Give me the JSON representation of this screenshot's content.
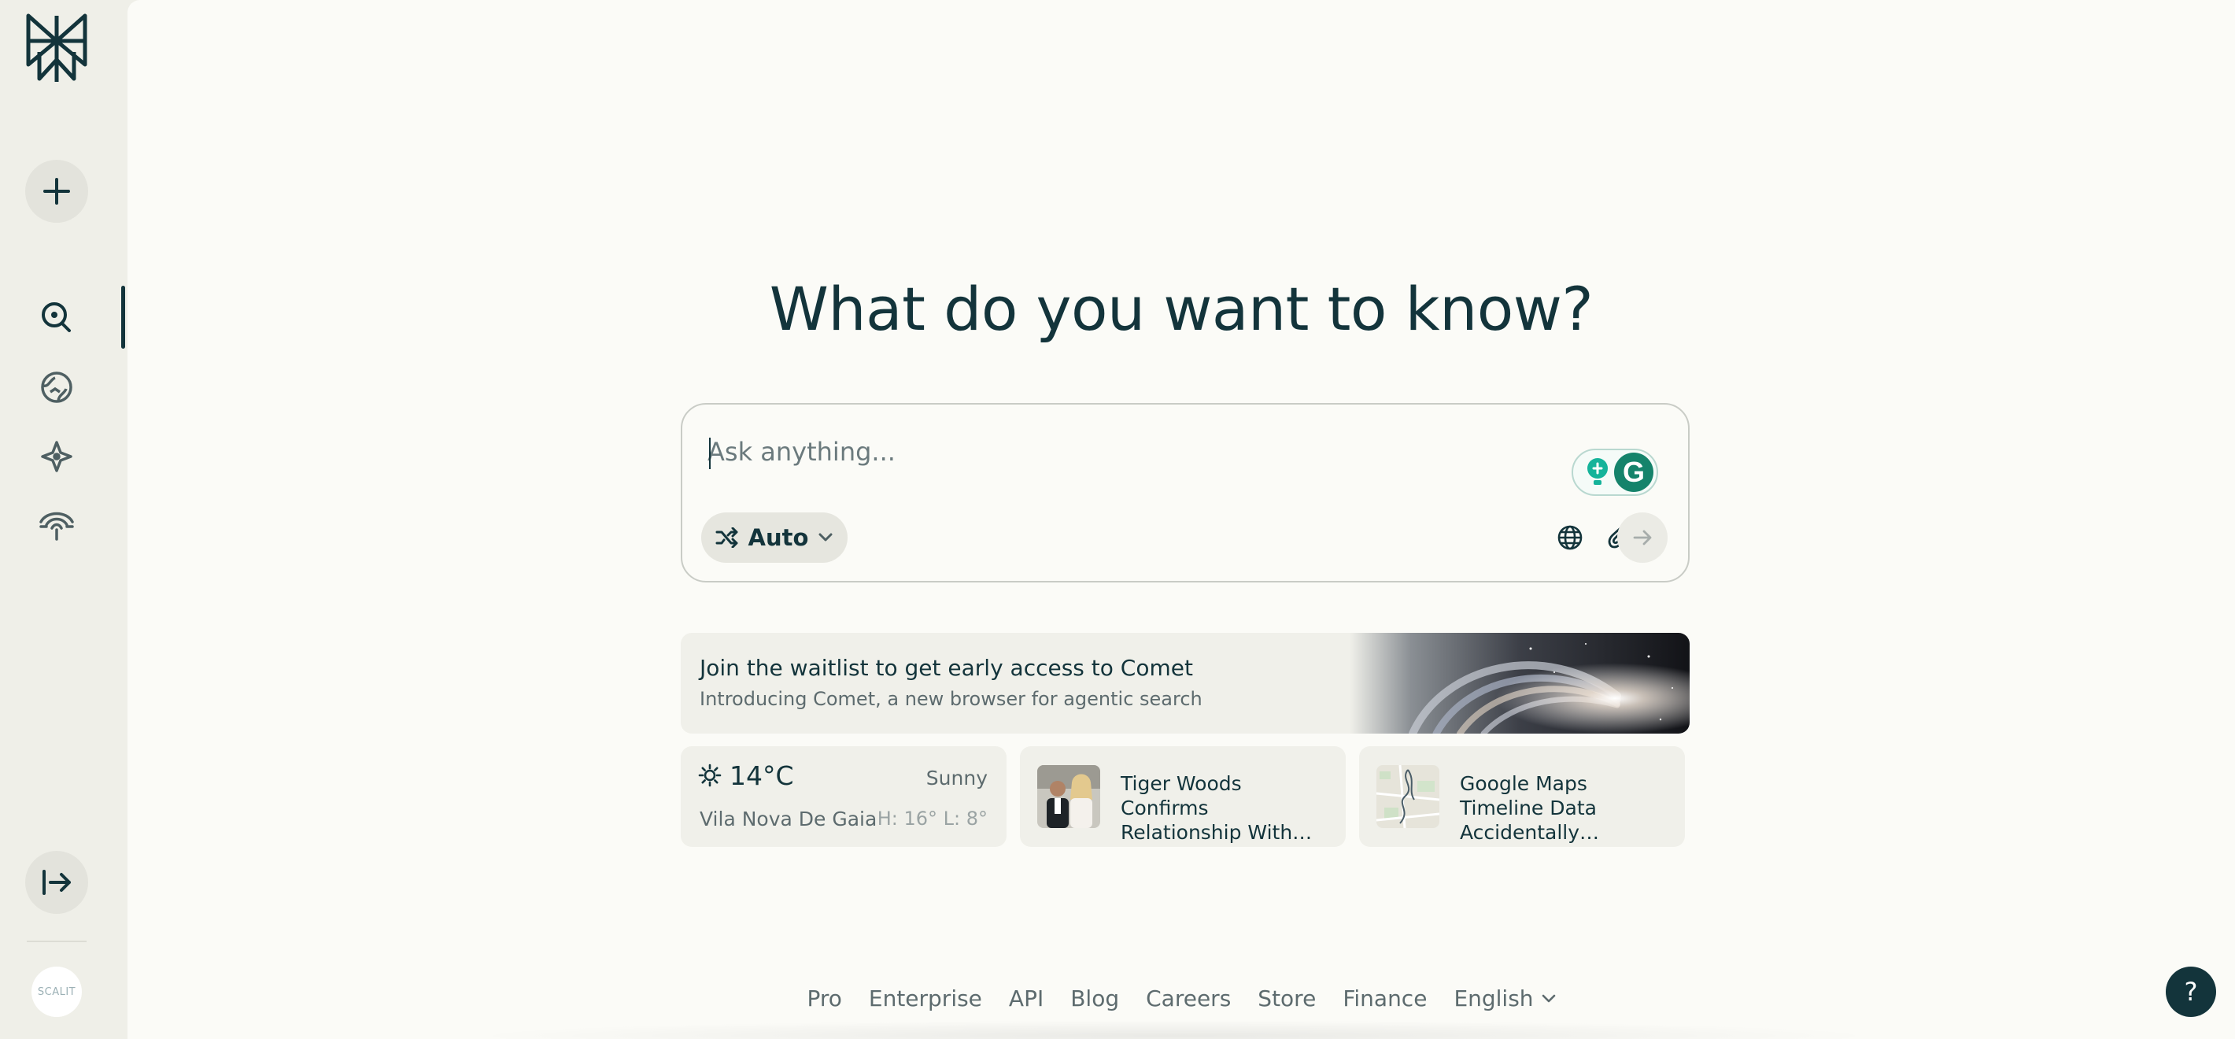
{
  "sidebar": {
    "logo": "perplexity-logo",
    "new_thread_icon": "plus-icon",
    "nav": [
      {
        "name": "search",
        "icon": "search-icon",
        "active": true
      },
      {
        "name": "discover",
        "icon": "globe-icon",
        "active": false
      },
      {
        "name": "spaces",
        "icon": "sparkle-icon",
        "active": false
      },
      {
        "name": "library",
        "icon": "signal-icon",
        "active": false
      }
    ],
    "expand_icon": "expand-icon",
    "avatar_text": "SCALIT"
  },
  "main": {
    "headline": "What do you want to know?",
    "ask": {
      "placeholder": "Ask anything...",
      "mode_label": "Auto",
      "grammarly_letter": "G"
    },
    "banner": {
      "title": "Join the waitlist to get early access to Comet",
      "subtitle": "Introducing Comet, a new browser for agentic search"
    },
    "weather": {
      "temperature": "14°C",
      "condition": "Sunny",
      "city": "Vila Nova De Gaia",
      "hilo": "H: 16° L: 8°"
    },
    "news": [
      {
        "title": "Tiger Woods Confirms Relationship With…"
      },
      {
        "title": "Google Maps Timeline Data Accidentally…"
      }
    ]
  },
  "footer": {
    "links": [
      "Pro",
      "Enterprise",
      "API",
      "Blog",
      "Careers",
      "Store",
      "Finance"
    ],
    "language": "English",
    "help_label": "?"
  },
  "colors": {
    "primary": "#13343b",
    "accent": "#15836b",
    "sidebar_bg": "#efefe8",
    "main_bg": "#fbfbf7"
  }
}
